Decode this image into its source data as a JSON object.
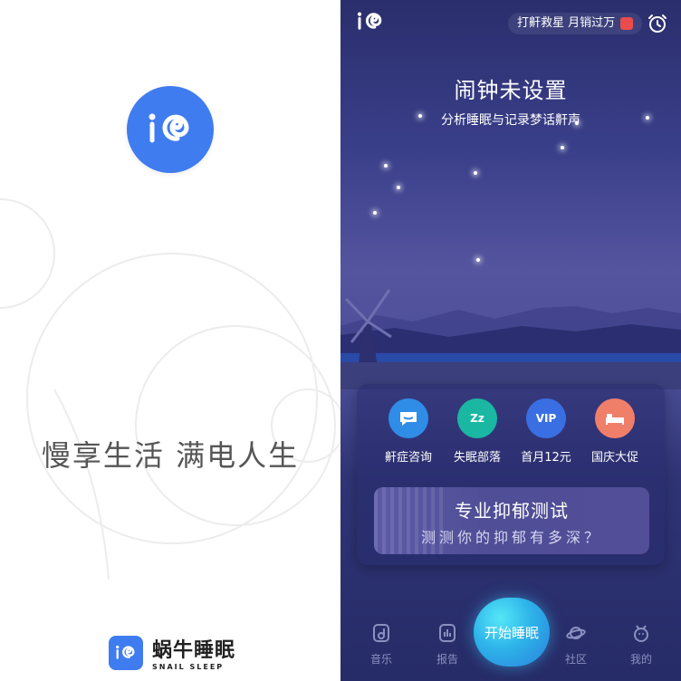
{
  "splash": {
    "slogan": "慢享生活  满电人生",
    "brand_cn": "蜗牛睡眠",
    "brand_en": "SNAIL SLEEP"
  },
  "sleep_app": {
    "promo_text": "打鼾救星 月销过万",
    "title": "闹钟未设置",
    "subtitle": "分析睡眠与记录梦话鼾声",
    "quick_items": [
      {
        "label": "鼾症咨询",
        "icon": "chat-bubble-icon",
        "color": "#2f8de8"
      },
      {
        "label": "失眠部落",
        "icon": "zzz-icon",
        "color": "#1ab7a3"
      },
      {
        "label": "首月12元",
        "icon": "vip-icon",
        "color": "#3a6fe4"
      },
      {
        "label": "国庆大促",
        "icon": "bed-icon",
        "color": "#f07f6a"
      }
    ],
    "test_banner": {
      "title": "专业抑郁测试",
      "subtitle": "测测你的抑郁有多深？"
    },
    "start_button": "开始睡眠",
    "nav": [
      {
        "label": "音乐",
        "icon": "music-icon"
      },
      {
        "label": "报告",
        "icon": "report-icon"
      },
      {
        "label": "社区",
        "icon": "planet-icon"
      },
      {
        "label": "我的",
        "icon": "profile-icon"
      }
    ],
    "alarm_icon": "alarm-clock-icon",
    "logo_icon": "snail-logo-icon"
  }
}
